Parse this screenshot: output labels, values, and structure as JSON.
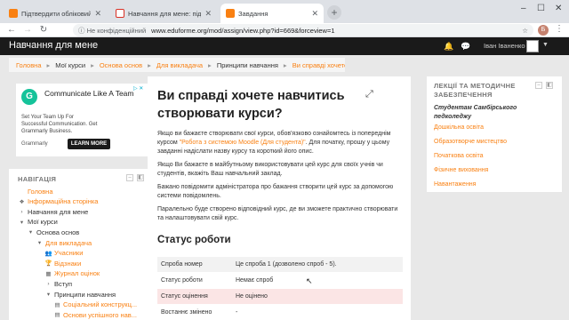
{
  "browser": {
    "tabs": [
      {
        "label": "Підтвердити обліковий запис",
        "active": false
      },
      {
        "label": "Навчання для мене: підтвердження",
        "active": false
      },
      {
        "label": "Завдання",
        "active": true
      }
    ],
    "new_tab": "+",
    "window_controls": [
      "–",
      "☐",
      "✕"
    ],
    "security_text": "Не конфіденційний",
    "url": "www.eduforme.org/mod/assign/view.php?id=669&forceview=1",
    "profile_letter": "Б"
  },
  "site": {
    "title": "Навчання для мене",
    "username": "Іван Іваненко"
  },
  "breadcrumb": [
    {
      "label": "Головна",
      "link": true
    },
    {
      "label": "Мої курси",
      "link": false
    },
    {
      "label": "Основа основ",
      "link": true
    },
    {
      "label": "Для викладача",
      "link": true
    },
    {
      "label": "Принципи навчання",
      "link": false
    },
    {
      "label": "Ви справді хочете нав...",
      "link": true
    }
  ],
  "ad": {
    "logo": "G",
    "title": "Communicate Like A Team",
    "body": "Set Your Team Up For Successful Communication. Get Grammarly Business.",
    "brand": "Grammarly",
    "cta": "LEARN MORE",
    "ad_choices": "▷ ✕"
  },
  "navigation": {
    "header": "НАВІГАЦІЯ",
    "items": [
      {
        "label": "Головна",
        "icon": "",
        "style": "link",
        "indent": 0
      },
      {
        "label": "Інформаційна сторінка",
        "icon": "❖",
        "style": "link",
        "indent": 0
      },
      {
        "label": "Навчання для мене",
        "icon": "›",
        "style": "plain",
        "indent": 0
      },
      {
        "label": "Мої курси",
        "icon": "▾",
        "style": "plain",
        "indent": 0
      },
      {
        "label": "Основа основ",
        "icon": "▾",
        "style": "plain",
        "indent": 1
      },
      {
        "label": "Для викладача",
        "icon": "▾",
        "style": "link",
        "indent": 2
      },
      {
        "label": "Учасники",
        "icon": "👥",
        "style": "link",
        "indent": 3
      },
      {
        "label": "Відзнаки",
        "icon": "🏆",
        "style": "link",
        "indent": 3
      },
      {
        "label": "Журнал оцінок",
        "icon": "▦",
        "style": "link",
        "indent": 3
      },
      {
        "label": "Вступ",
        "icon": "›",
        "style": "plain",
        "indent": 3
      },
      {
        "label": "Принципи навчання",
        "icon": "▾",
        "style": "plain",
        "indent": 3
      },
      {
        "label": "Соціальний конструкц...",
        "icon": "▤",
        "style": "link",
        "indent": 4
      },
      {
        "label": "Основи успішного нав...",
        "icon": "▤",
        "style": "link",
        "indent": 4
      }
    ]
  },
  "assignment": {
    "title": "Ви справді хочете навчитись створювати курси?",
    "p1_before": "Якщо ви бажаєте створювати свої курси, обов'язково ознайомтесь із попереднім курсом ",
    "p1_link": "\"Робота з системою Moodle (Для студента)\"",
    "p1_after": ". Для початку, прошу у цьому завданні надіслати назву курсу та короткий його опис.",
    "p2": "Якщо Ви бажаєте в майбутньому використовувати цей курс для своїх учнів чи студентів, вкажіть Ваш навчальний заклад.",
    "p3": "Бажано повідомити адміністратора про бажання створити цей курс за допомогою системи повідомлень.",
    "p4": "Паралельно буде створено відповідний курс, де ви зможете практично створювати та налаштовувати свій курс.",
    "status_heading": "Статус роботи",
    "status_rows": [
      {
        "key": "Спроба номер",
        "value": "Це спроба 1 (дозволено спроб - 5)."
      },
      {
        "key": "Статус роботи",
        "value": "Немає спроб"
      },
      {
        "key": "Статус оцінення",
        "value": "Не оцінено"
      },
      {
        "key": "Востаннє змінено",
        "value": "-"
      }
    ]
  },
  "right_block": {
    "header": "ЛЕКЦІЇ ТА МЕТОДИЧНЕ ЗАБЕЗПЕЧЕННЯ",
    "subtitle": "Студентам Самбірського педколеджу",
    "links": [
      "Дошкільна освіта",
      "Образотворче мистецтво",
      "Початкова освіта",
      "Фізичне виховання",
      "Навантаження"
    ]
  },
  "colors": {
    "accent": "#f98012",
    "topbar": "#1a1a1a",
    "page_bg": "#e8e8e8"
  }
}
